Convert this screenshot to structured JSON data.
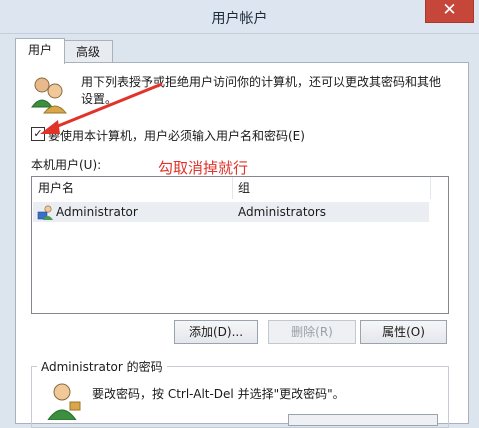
{
  "window": {
    "title": "用户帐户",
    "close_glyph": "✕"
  },
  "tabs": [
    {
      "label": "用户",
      "active": true
    },
    {
      "label": "高级",
      "active": false
    }
  ],
  "description": "用下列表授予或拒绝用户访问你的计算机，还可以更改其密码和其他设置。",
  "require_login": {
    "checked": true,
    "label": "要使用本计算机，用户必须输入用户名和密码(E)"
  },
  "annotation": "勾取消掉就行",
  "users_section": {
    "label": "本机用户(U):",
    "columns": [
      "用户名",
      "组"
    ],
    "rows": [
      {
        "username": "Administrator",
        "group": "Administrators"
      }
    ]
  },
  "buttons": {
    "add": "添加(D)...",
    "remove": "删除(R)",
    "properties": "属性(O)"
  },
  "password_section": {
    "title": "Administrator 的密码",
    "text": "要改密码，按 Ctrl-Alt-Del 并选择\"更改密码\"。"
  },
  "colors": {
    "annotation": "#e0332a",
    "close_button": "#c7463a",
    "titlebar": "#dde6f0"
  },
  "icons": [
    "close-icon",
    "users-icon",
    "user-icon",
    "password-user-icon",
    "arrow-annotation-icon"
  ]
}
